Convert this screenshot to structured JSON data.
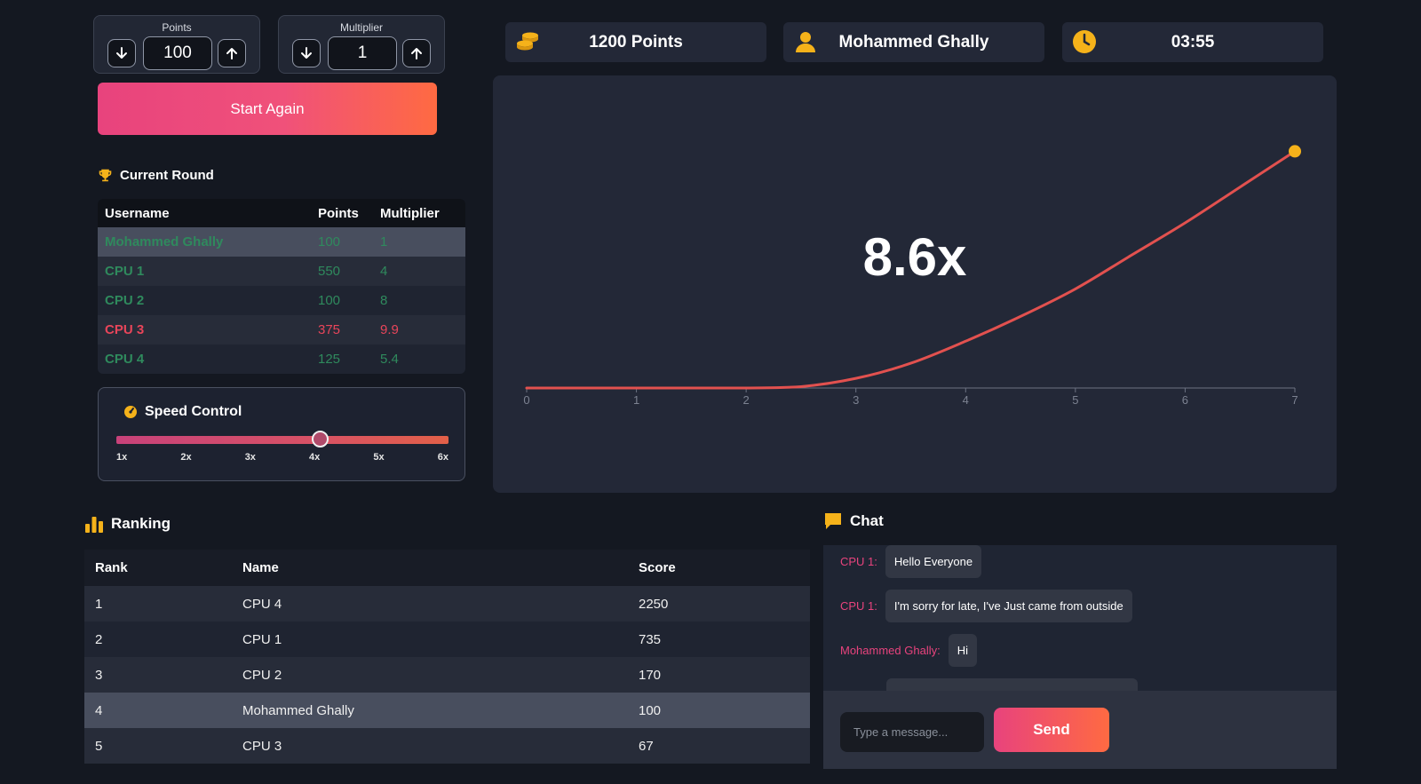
{
  "controls": {
    "points": {
      "label": "Points",
      "value": "100"
    },
    "multiplier": {
      "label": "Multiplier",
      "value": "1"
    },
    "start_label": "Start Again"
  },
  "current_round": {
    "title": "Current Round",
    "headers": [
      "Username",
      "Points",
      "Multiplier"
    ],
    "rows": [
      {
        "username": "Mohammed Ghally",
        "points": "100",
        "multiplier": "1",
        "status": "win",
        "highlight": true
      },
      {
        "username": "CPU 1",
        "points": "550",
        "multiplier": "4",
        "status": "win"
      },
      {
        "username": "CPU 2",
        "points": "100",
        "multiplier": "8",
        "status": "win"
      },
      {
        "username": "CPU 3",
        "points": "375",
        "multiplier": "9.9",
        "status": "lose"
      },
      {
        "username": "CPU 4",
        "points": "125",
        "multiplier": "5.4",
        "status": "win"
      }
    ]
  },
  "speed_control": {
    "title": "Speed Control",
    "ticks": [
      "1x",
      "2x",
      "3x",
      "4x",
      "5x",
      "6x"
    ],
    "value": 4
  },
  "stats": {
    "points": "1200 Points",
    "user": "Mohammed Ghally",
    "time": "03:55"
  },
  "graph": {
    "multiplier": "8.6x",
    "x_ticks": [
      "0",
      "1",
      "2",
      "3",
      "4",
      "5",
      "6",
      "7"
    ]
  },
  "chart_data": {
    "type": "line",
    "x": [
      0,
      1,
      2,
      2.5,
      3,
      3.5,
      4,
      4.5,
      5,
      5.5,
      6,
      6.5,
      7
    ],
    "y": [
      0,
      0,
      0,
      0.05,
      0.35,
      0.9,
      1.7,
      2.6,
      3.6,
      4.8,
      6.0,
      7.3,
      8.6
    ],
    "xlim": [
      0,
      7
    ],
    "ylim": [
      0,
      10
    ],
    "color": "#e2514f",
    "endpoint_color": "#f5b21a"
  },
  "ranking": {
    "title": "Ranking",
    "headers": [
      "Rank",
      "Name",
      "Score"
    ],
    "rows": [
      {
        "rank": "1",
        "name": "CPU 4",
        "score": "2250"
      },
      {
        "rank": "2",
        "name": "CPU 1",
        "score": "735"
      },
      {
        "rank": "3",
        "name": "CPU 2",
        "score": "170"
      },
      {
        "rank": "4",
        "name": "Mohammed Ghally",
        "score": "100",
        "highlight": true
      },
      {
        "rank": "5",
        "name": "CPU 3",
        "score": "67"
      }
    ]
  },
  "chat": {
    "title": "Chat",
    "messages": [
      {
        "who": "CPU 1:",
        "text": "Hello Everyone"
      },
      {
        "who": "CPU 1:",
        "text": "I'm sorry for late, I've Just came from outside"
      },
      {
        "who": "Mohammed Ghally:",
        "text": "Hi"
      }
    ],
    "placeholder": "Type a message...",
    "send_label": "Send"
  },
  "colors": {
    "accent_pink": "#e8437d",
    "accent_orange": "#ff6a42",
    "icon_gold": "#f5b21a",
    "win_green": "#2f8a5d",
    "lose_red": "#e8455a"
  }
}
